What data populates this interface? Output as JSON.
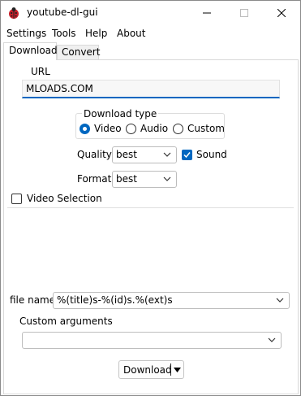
{
  "window": {
    "title": "youtube-dl-gui",
    "app_icon": "ladybug-icon"
  },
  "menubar": {
    "items": [
      "Settings",
      "Tools",
      "Help",
      "About"
    ]
  },
  "tabs": [
    {
      "label": "Download",
      "active": true
    },
    {
      "label": "Convert",
      "active": false
    }
  ],
  "download": {
    "url_label": "URL",
    "url_value": "MLOADS.COM",
    "download_type": {
      "title": "Download type",
      "options": [
        "Video",
        "Audio",
        "Custom"
      ],
      "selected": "Video"
    },
    "quality": {
      "label": "Quality",
      "value": "best"
    },
    "sound": {
      "label": "Sound",
      "checked": true
    },
    "format": {
      "label": "Format",
      "value": "best"
    },
    "video_selection": {
      "label": "Video Selection",
      "checked": false
    },
    "file_name": {
      "label": "file name",
      "value": "%(title)s-%(id)s.%(ext)s"
    },
    "custom_arguments": {
      "label": "Custom arguments",
      "value": ""
    },
    "download_button": {
      "label": "Download"
    }
  },
  "colors": {
    "accent": "#0067c0",
    "tab_inactive": "#f0f0f0",
    "border": "#d9d9d9"
  }
}
